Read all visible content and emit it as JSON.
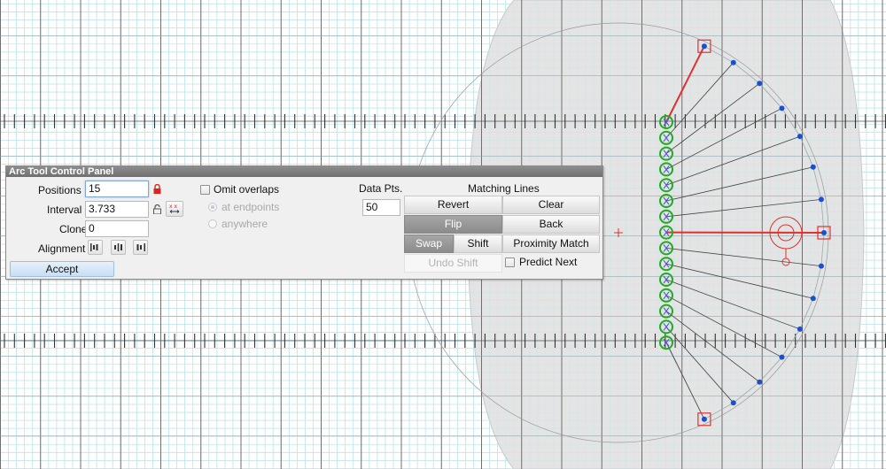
{
  "panel": {
    "title": "Arc Tool Control Panel",
    "positions_label": "Positions",
    "positions_value": "15",
    "interval_label": "Interval",
    "interval_value": "3.733",
    "clone_label": "Clone",
    "clone_value": "0",
    "alignment_label": "Alignment",
    "accept_label": "Accept",
    "omit_overlaps_label": "Omit overlaps",
    "omit_overlaps_checked": false,
    "at_endpoints_label": "at endpoints",
    "anywhere_label": "anywhere",
    "data_pts_label": "Data Pts.",
    "data_pts_value": "50",
    "matching_lines_label": "Matching Lines",
    "revert_label": "Revert",
    "clear_label": "Clear",
    "flip_label": "Flip",
    "back_label": "Back",
    "swap_label": "Swap",
    "shift_label": "Shift",
    "proximity_match_label": "Proximity Match",
    "undo_shift_label": "Undo Shift",
    "predict_next_label": "Predict Next",
    "predict_next_checked": false
  },
  "icons": {
    "lock": "lock-closed-icon",
    "unlock": "lock-open-icon",
    "interval_toggle": "interval-arrows-icon",
    "align_left": "align-left-icon",
    "align_center": "align-center-icon",
    "align_right": "align-right-icon"
  },
  "canvas": {
    "spoke_count": 15
  },
  "colors": {
    "grid_minor": "#bfe4ea",
    "grid_major": "#6f6f6f",
    "shaded_region": "#e4e4e4",
    "arc_red": "#e03030",
    "node_green": "#22aa22",
    "point_blue": "#1a4fd0",
    "panel_bg": "#f0f0f0",
    "title_bar": "#7a7a7a",
    "accept_blue": "#c7def3"
  }
}
